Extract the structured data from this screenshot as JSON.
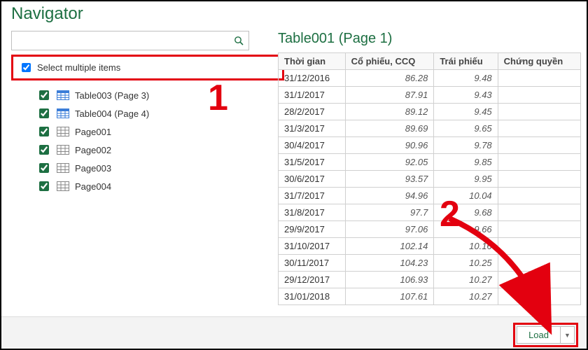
{
  "title": "Navigator",
  "search": {
    "placeholder": ""
  },
  "select_multiple_label": "Select multiple items",
  "tree": [
    {
      "label": "Table003 (Page 3)",
      "icon": "table",
      "checked": true
    },
    {
      "label": "Table004 (Page 4)",
      "icon": "table",
      "checked": true
    },
    {
      "label": "Page001",
      "icon": "page",
      "checked": true
    },
    {
      "label": "Page002",
      "icon": "page",
      "checked": true
    },
    {
      "label": "Page003",
      "icon": "page",
      "checked": true
    },
    {
      "label": "Page004",
      "icon": "page",
      "checked": true
    }
  ],
  "callouts": {
    "one": "1",
    "two": "2"
  },
  "preview": {
    "title": "Table001 (Page 1)",
    "columns": [
      "Thời gian",
      "Cổ phiếu, CCQ",
      "Trái phiếu",
      "Chứng quyền"
    ],
    "rows": [
      [
        "31/12/2016",
        "86.28",
        "9.48",
        ""
      ],
      [
        "31/1/2017",
        "87.91",
        "9.43",
        ""
      ],
      [
        "28/2/2017",
        "89.12",
        "9.45",
        ""
      ],
      [
        "31/3/2017",
        "89.69",
        "9.65",
        ""
      ],
      [
        "30/4/2017",
        "90.96",
        "9.78",
        ""
      ],
      [
        "31/5/2017",
        "92.05",
        "9.85",
        ""
      ],
      [
        "30/6/2017",
        "93.57",
        "9.95",
        ""
      ],
      [
        "31/7/2017",
        "94.96",
        "10.04",
        ""
      ],
      [
        "31/8/2017",
        "97.7",
        "9.68",
        ""
      ],
      [
        "29/9/2017",
        "97.06",
        "9.66",
        ""
      ],
      [
        "31/10/2017",
        "102.14",
        "10.16",
        ""
      ],
      [
        "30/11/2017",
        "104.23",
        "10.25",
        ""
      ],
      [
        "29/12/2017",
        "106.93",
        "10.27",
        ""
      ],
      [
        "31/01/2018",
        "107.61",
        "10.27",
        ""
      ]
    ]
  },
  "footer": {
    "load": "Load"
  }
}
